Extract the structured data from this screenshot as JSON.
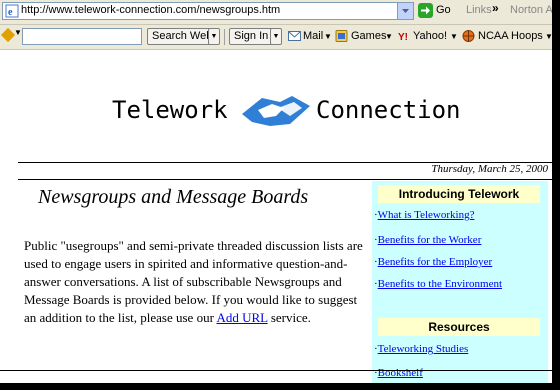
{
  "browser": {
    "url": "http://www.telework-connection.com/newsgroups.htm",
    "go_label": "Go",
    "links_label": "Links",
    "more_glyph": "»",
    "norton_label": "Norton Ant",
    "icons": [
      "ie-page-icon",
      "dropdown-arrow-icon",
      "go-arrow-icon",
      "pen-icon",
      "mail-icon",
      "games-icon",
      "yahoo-icon",
      "ncaa-icon"
    ]
  },
  "toolbar": {
    "search_input_value": "",
    "search_label": "Search Web",
    "signin_label": "Sign In",
    "mail_label": "Mail",
    "games_label": "Games",
    "yahoo_label": "Yahoo!",
    "ncaa_label": "NCAA Hoops"
  },
  "page": {
    "logo_left": "Telework",
    "logo_right": "Connection",
    "date": "Thursday, March 25, 2000",
    "heading": "Newsgroups and Message Boards",
    "body_before": "Public \"usegroups\" and semi-private threaded discussion lists are used to engage users in spirited and informative question-and-answer conversations. A list of subscribable Newsgroups and Message Boards is provided below. If you would like to suggest an addition to the list, please use our ",
    "body_link": "Add URL",
    "body_after": " service."
  },
  "sidebar": {
    "section1_title": "Introducing Telework",
    "section1_links": [
      "What is Teleworking?",
      "Benefits for the Worker",
      "Benefits for the Employer",
      "Benefits to the Environment"
    ],
    "section2_title": "Resources",
    "section2_links": [
      "Teleworking Studies",
      "Bookshelf"
    ],
    "bullet": "·"
  },
  "colors": {
    "sidebar_bg": "#ccffff",
    "sidebar_header_bg": "#ffffcc",
    "link": "#0000ee",
    "chrome": "#ece9d8",
    "go_green": "#2aa52a"
  }
}
